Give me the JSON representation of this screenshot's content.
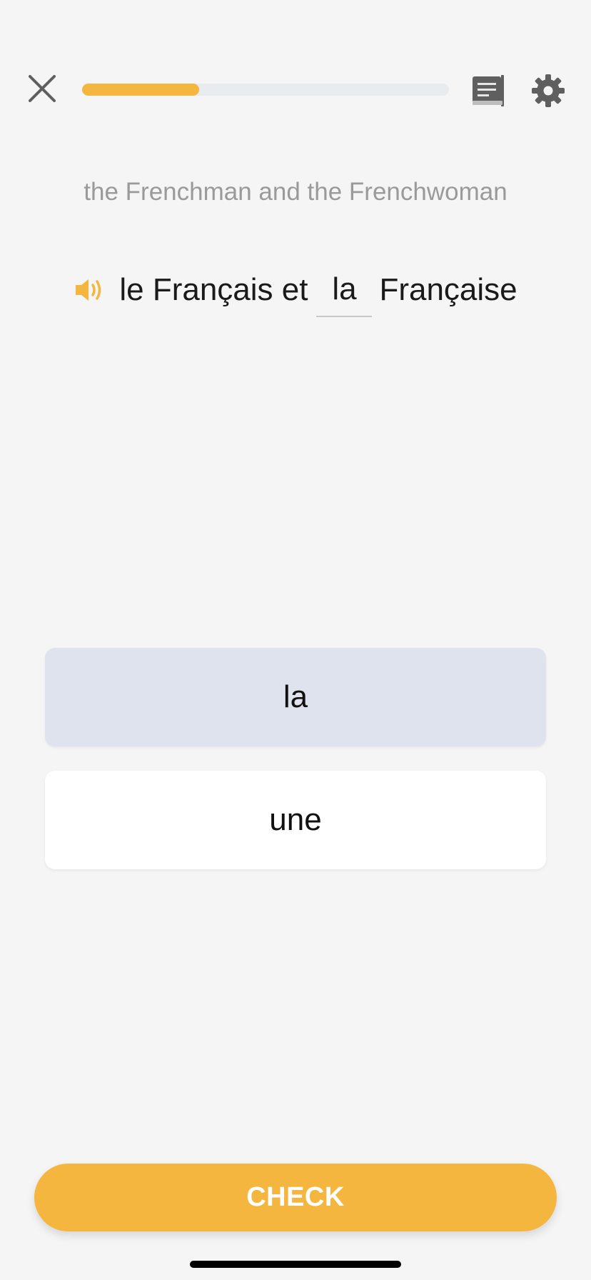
{
  "header": {
    "close_icon": "close-icon",
    "progress_percent": 32,
    "notes_icon": "notes-icon",
    "settings_icon": "gear-icon"
  },
  "exercise": {
    "translation": "the Frenchman and the Frenchwoman",
    "sentence_before": "le Français et",
    "blank_value": "la",
    "sentence_after": "Française",
    "speaker_icon": "speaker-icon"
  },
  "options": [
    {
      "label": "la",
      "selected": true
    },
    {
      "label": "une",
      "selected": false
    }
  ],
  "footer": {
    "check_label": "CHECK"
  },
  "colors": {
    "accent": "#f4b63f",
    "progress_track": "#e8ecef",
    "selected_option": "#dfe3ee",
    "icon_gray": "#5f5f5f"
  }
}
